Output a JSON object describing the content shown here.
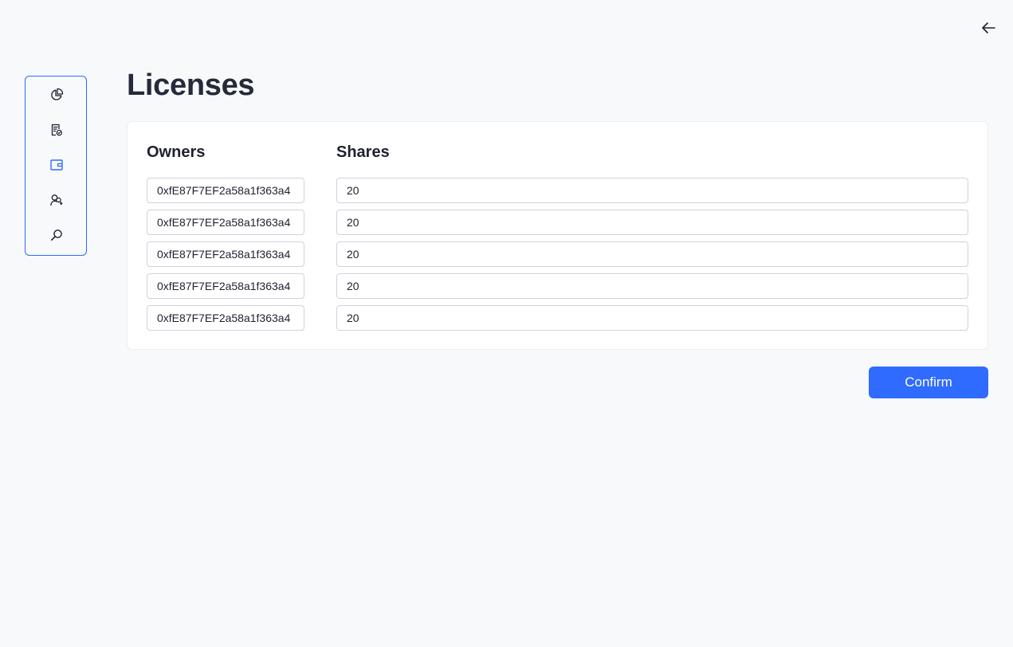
{
  "header": {
    "back_icon": "arrow-left-icon"
  },
  "sidebar": {
    "active_color": "#2f6bff",
    "items": [
      {
        "icon": "pie-chart-icon",
        "active": false
      },
      {
        "icon": "document-badge-icon",
        "active": false
      },
      {
        "icon": "wallet-icon",
        "active": true
      },
      {
        "icon": "users-icon",
        "active": false
      },
      {
        "icon": "search-icon",
        "active": false
      }
    ]
  },
  "page": {
    "title": "Licenses"
  },
  "table": {
    "owners_header": "Owners",
    "shares_header": "Shares",
    "rows": [
      {
        "owner": "0xfE87F7EF2a58a1f363a4",
        "share": "20"
      },
      {
        "owner": "0xfE87F7EF2a58a1f363a4",
        "share": "20"
      },
      {
        "owner": "0xfE87F7EF2a58a1f363a4",
        "share": "20"
      },
      {
        "owner": "0xfE87F7EF2a58a1f363a4",
        "share": "20"
      },
      {
        "owner": "0xfE87F7EF2a58a1f363a4",
        "share": "20"
      }
    ]
  },
  "actions": {
    "confirm_label": "Confirm",
    "accent_color": "#2f6bff"
  }
}
